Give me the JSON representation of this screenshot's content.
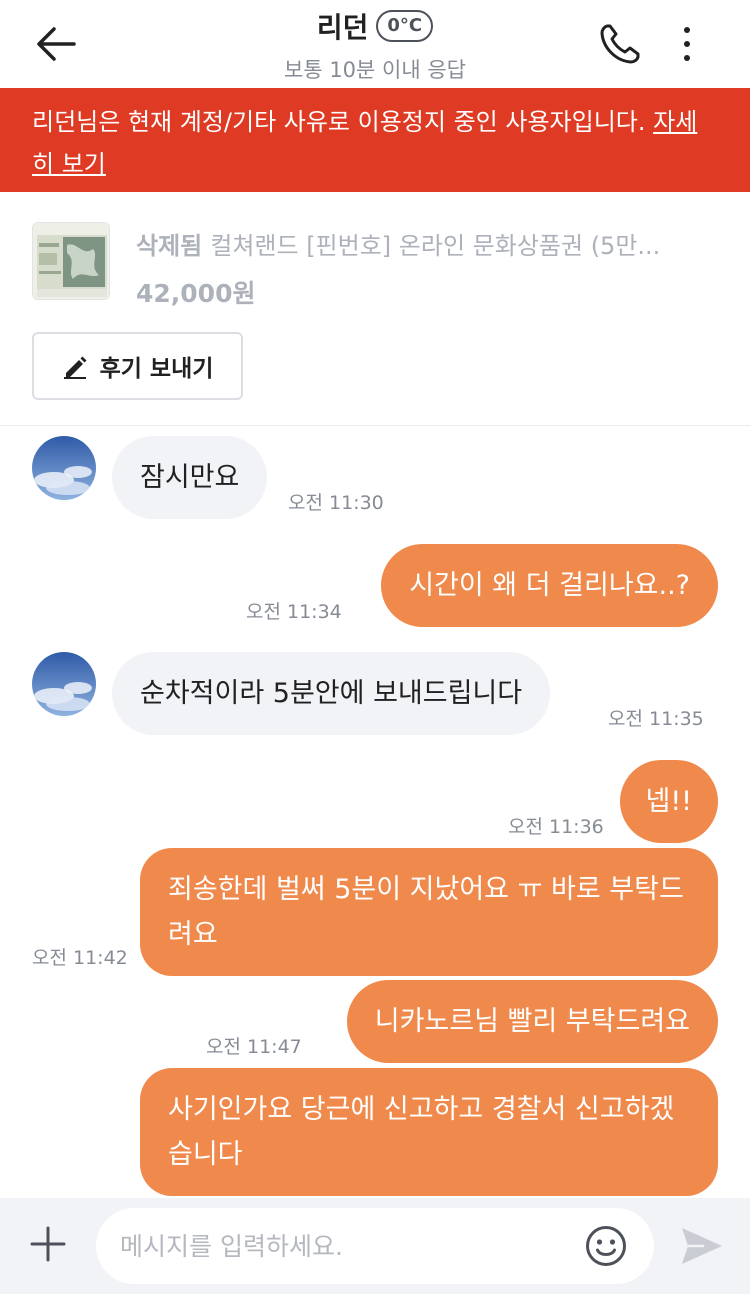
{
  "header": {
    "title": "리던",
    "temperature": "0°C",
    "subtitle": "보통 10분 이내 응답"
  },
  "warning": {
    "text": "리던님은 현재 계정/기타 사유로 이용정지 중인 사용자입니다. ",
    "link_label": "자세히 보기"
  },
  "product": {
    "status": "삭제됨",
    "title": "컬쳐랜드 [핀번호] 온라인 문화상품권 (5만...",
    "price": "42,000원",
    "review_button": "후기 보내기"
  },
  "messages": [
    {
      "direction": "in",
      "text": "잠시만요",
      "time": "오전 11:30"
    },
    {
      "direction": "out",
      "text": "시간이 왜 더 걸리나요..?",
      "time": "오전 11:34"
    },
    {
      "direction": "in",
      "text": "순차적이라 5분안에  보내드립니다",
      "time": "오전 11:35"
    },
    {
      "direction": "out",
      "text": "넵!!",
      "time": "오전 11:36"
    },
    {
      "direction": "out",
      "text": "죄송한데 벌써 5분이 지났어요 ㅠ 바로 부탁드려요",
      "time": "오전 11:42"
    },
    {
      "direction": "out",
      "text": "니카노르님 빨리 부탁드려요",
      "time": "오전 11:47"
    },
    {
      "direction": "out",
      "text": "사기인가요 당근에 신고하고 경찰서 신고하겠습니다",
      "time": ""
    }
  ],
  "input": {
    "placeholder": "메시지를 입력하세요."
  },
  "icons": {
    "back": "arrow-left-icon",
    "call": "phone-icon",
    "more": "more-vertical-icon",
    "edit": "pencil-icon",
    "plus": "plus-icon",
    "emoji": "smile-icon",
    "send": "send-icon"
  },
  "colors": {
    "warning_bg": "#de3a24",
    "outgoing_bubble": "#ef8a4c",
    "incoming_bubble": "#f2f3f6"
  }
}
